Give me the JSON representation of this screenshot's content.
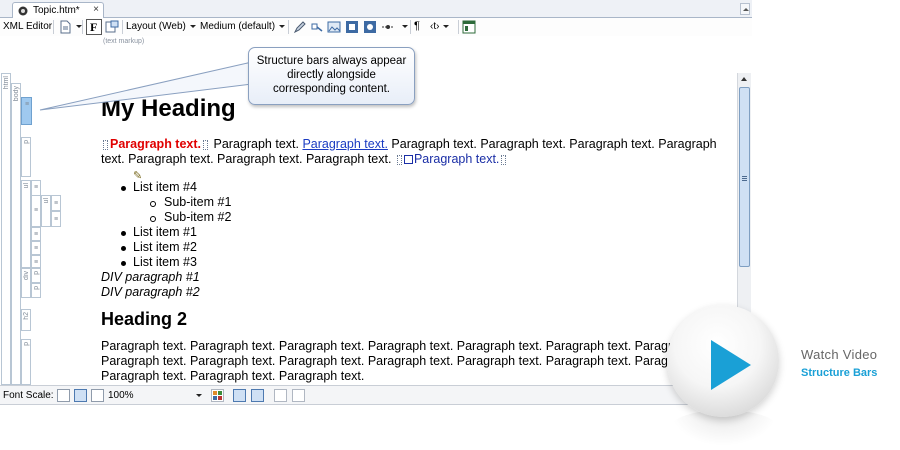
{
  "tab": {
    "label": "Topic.htm*",
    "close": "×"
  },
  "toolbar": {
    "editor_label": "XML Editor",
    "bold_label": "F",
    "layout_label": "Layout (Web)",
    "medium_label": "Medium (default)",
    "pilcrow_label": "¶",
    "tag_label": "‹t›",
    "sub_label": "(text markup)"
  },
  "structure_bars": {
    "html": "html",
    "body": "body",
    "p1": "p",
    "ul": "ul",
    "ul2": "ul",
    "div": "div",
    "p2": "p",
    "p3": "p",
    "h2": "h2",
    "p4": "p"
  },
  "document": {
    "heading1": "My Heading",
    "para1": {
      "red": "Paragraph text.",
      "plain1": "Paragraph text.",
      "link": "Paragraph text.",
      "plain2": "Paragraph text. Paragraph text. Paragraph text. Paragraph text. Paragraph text. Paragraph text. Paragraph text.",
      "navy": "Paragraph text."
    },
    "list": [
      {
        "text": "List item #4",
        "sub": false
      },
      {
        "text": "Sub-item #1",
        "sub": true
      },
      {
        "text": "Sub-item #2",
        "sub": true
      },
      {
        "text": "List item #1",
        "sub": false
      },
      {
        "text": "List item #2",
        "sub": false
      },
      {
        "text": "List item #3",
        "sub": false
      }
    ],
    "div_paragraphs": [
      "DIV paragraph #1",
      "DIV paragraph #2"
    ],
    "heading2": "Heading 2",
    "para2_lines": [
      "Paragraph text. Paragraph text. Paragraph text. Paragraph text. Paragraph text. Paragraph text. Paragraph text. Paragraph text.",
      "Paragraph text. Paragraph text. Paragraph text. Paragraph text. Paragraph text. Paragraph text. Paragraph text. Paragraph text.",
      "Paragraph text. Paragraph text. Paragraph text."
    ]
  },
  "statusbar": {
    "font_scale_label": "Font Scale:",
    "zoom": "100%"
  },
  "callout": {
    "line1": "Structure bars always appear",
    "line2": "directly alongside",
    "line3": "corresponding content."
  },
  "video": {
    "title": "Watch Video",
    "subtitle": "Structure Bars"
  },
  "colors": {
    "accent": "#1aa0d6",
    "link": "#1a3bc2",
    "emphasis": "#e00000",
    "structure_selected": "#9fc9ef"
  }
}
